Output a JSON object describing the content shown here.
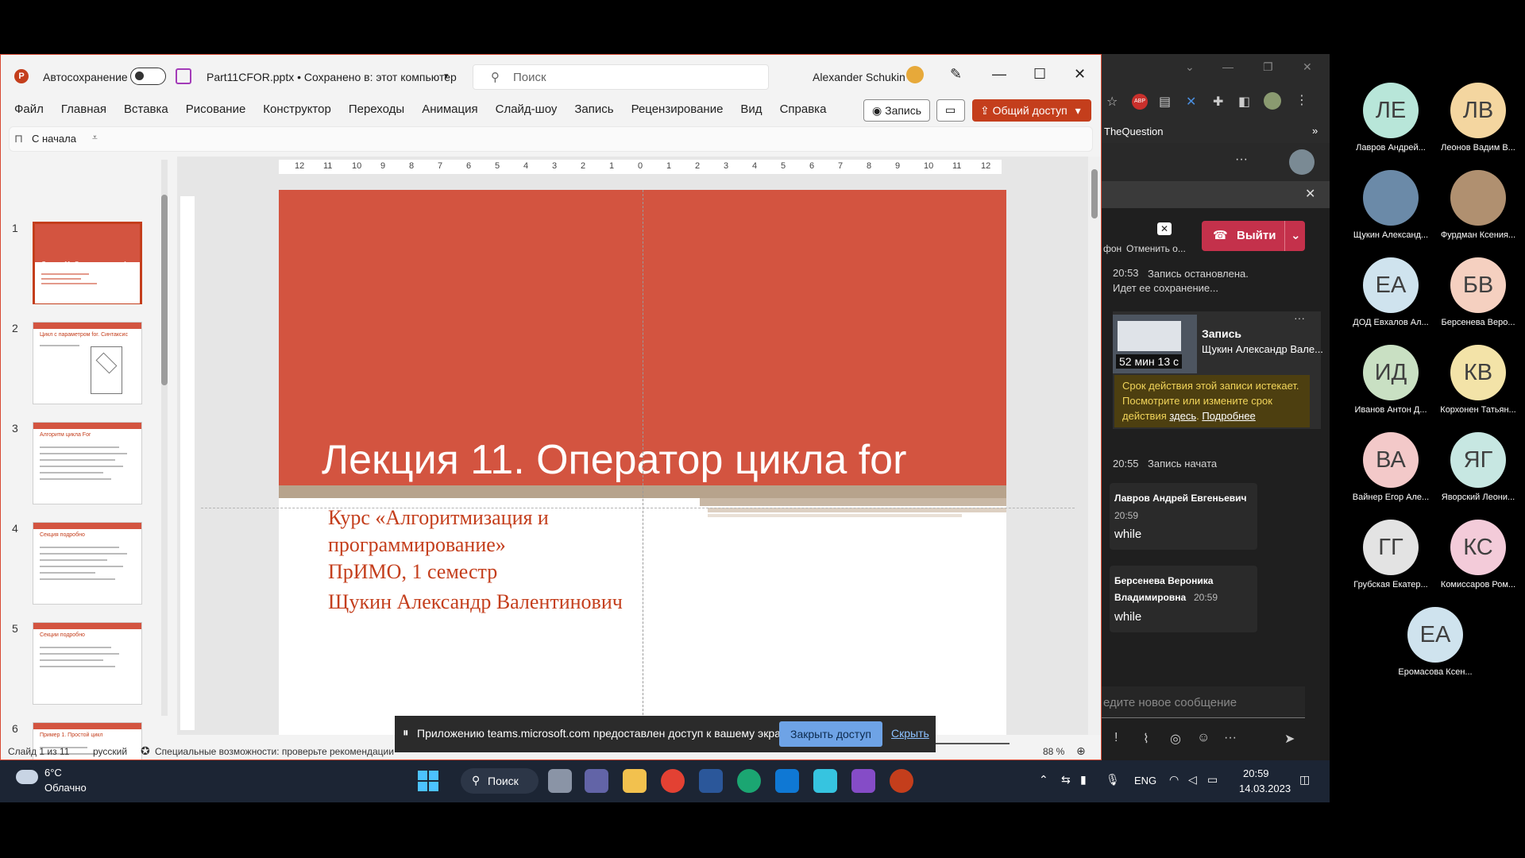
{
  "ppt": {
    "autosave_label": "Автосохранение",
    "file_title": "Part11CFOR.pptx • Сохранено в: этот компьютер",
    "search_placeholder": "Поиск",
    "user_name": "Alexander Schukin",
    "menu": [
      "Файл",
      "Главная",
      "Вставка",
      "Рисование",
      "Конструктор",
      "Переходы",
      "Анимация",
      "Слайд-шоу",
      "Запись",
      "Рецензирование",
      "Вид",
      "Справка"
    ],
    "record_btn": "Запись",
    "share_btn": "Общий доступ",
    "from_start": "С начала",
    "slide_numbers": [
      "1",
      "2",
      "3",
      "4",
      "5",
      "6"
    ],
    "thumbnail_titles": [
      "Лекция 11. Оператор цикла for",
      "Цикл с параметром for. Синтаксис",
      "Алгоритм цикла For",
      "Секция подробно",
      "Секции подробно",
      "Пример 1. Простой цикл"
    ],
    "ruler_labels": [
      "12",
      "11",
      "10",
      "9",
      "8",
      "7",
      "6",
      "5",
      "4",
      "3",
      "2",
      "1",
      "0",
      "1",
      "2",
      "3",
      "4",
      "5",
      "6",
      "7",
      "8",
      "9",
      "10",
      "11",
      "12"
    ],
    "slide_title": "Лекция 11. Оператор цикла for",
    "slide_sub_lines": [
      "Курс «Алгоритмизация и",
      "программирование»",
      "ПрИМО, 1 семестр",
      "Щукин Александр Валентинович"
    ],
    "status_slide": "Слайд 1 из 11",
    "status_lang": "русский",
    "status_access": "Специальные возможности: проверьте рекомендации",
    "zoom": "88 %"
  },
  "banner": {
    "text": "Приложению teams.microsoft.com предоставлен доступ к вашему экрану.",
    "close_btn": "Закрыть доступ",
    "hide": "Скрыть"
  },
  "teams": {
    "bookmark": "TheQuestion",
    "cancel_label": "Отменить о...",
    "phone_label": "фон",
    "exit_btn": "Выйти",
    "sys1_time": "20:53",
    "sys1_text": "Запись остановлена. Идет ее сохранение...",
    "rec_duration": "52 мин 13 с",
    "rec_title": "Запись",
    "rec_author": "Щукин Александр Вале...",
    "rec_warn_text": "Срок действия этой записи истекает. Посмотрите или измените срок действия ",
    "rec_warn_link1": "здесь",
    "rec_warn_link2": "Подробнее",
    "sys2_time": "20:55",
    "sys2_text": "Запись начата",
    "msg1_author": "Лавров Андрей Евгеньевич",
    "msg1_time": "20:59",
    "msg1_text": "while",
    "msg2_author_l1": "Берсенева Вероника",
    "msg2_author_l2": "Владимировна",
    "msg2_time": "20:59",
    "msg2_text": "while",
    "compose_placeholder": "едите новое сообщение"
  },
  "participants": [
    {
      "initials": "ЛЕ",
      "name": "Лавров Андрей...",
      "color": "#b8e6d9"
    },
    {
      "initials": "ЛВ",
      "name": "Леонов Вадим В...",
      "color": "#f4d6a0"
    },
    {
      "initials": "",
      "name": "Щукин Александ...",
      "color": "#6b8aa8"
    },
    {
      "initials": "",
      "name": "Фурдман Ксения...",
      "color": "#b09070"
    },
    {
      "initials": "ЕА",
      "name": "ДОД Евхалов Ал...",
      "color": "#cfe3ee"
    },
    {
      "initials": "БВ",
      "name": "Берсенева Веро...",
      "color": "#f5d0c0"
    },
    {
      "initials": "ИД",
      "name": "Иванов Антон Д...",
      "color": "#c9e0c3"
    },
    {
      "initials": "КВ",
      "name": "Корхонен Татьян...",
      "color": "#f3e3a8"
    },
    {
      "initials": "ВА",
      "name": "Вайнер Егор Але...",
      "color": "#f3c9c9"
    },
    {
      "initials": "ЯГ",
      "name": "Яворский Леони...",
      "color": "#c7e7e2"
    },
    {
      "initials": "ГГ",
      "name": "Грубская Екатер...",
      "color": "#e3e3e3"
    },
    {
      "initials": "КС",
      "name": "Комиссаров Ром...",
      "color": "#f3cbd9"
    },
    {
      "initials": "ЕА",
      "name": "Еромасова Ксен...",
      "color": "#cfe3ee"
    }
  ],
  "taskbar": {
    "weather_temp": "6°C",
    "weather_desc": "Облачно",
    "search": "Поиск",
    "lang": "ENG",
    "time": "20:59",
    "date": "14.03.2023"
  },
  "colors": {
    "accent": "#c43e1c",
    "slide_red": "#d35440",
    "teams_red": "#c4314b"
  }
}
